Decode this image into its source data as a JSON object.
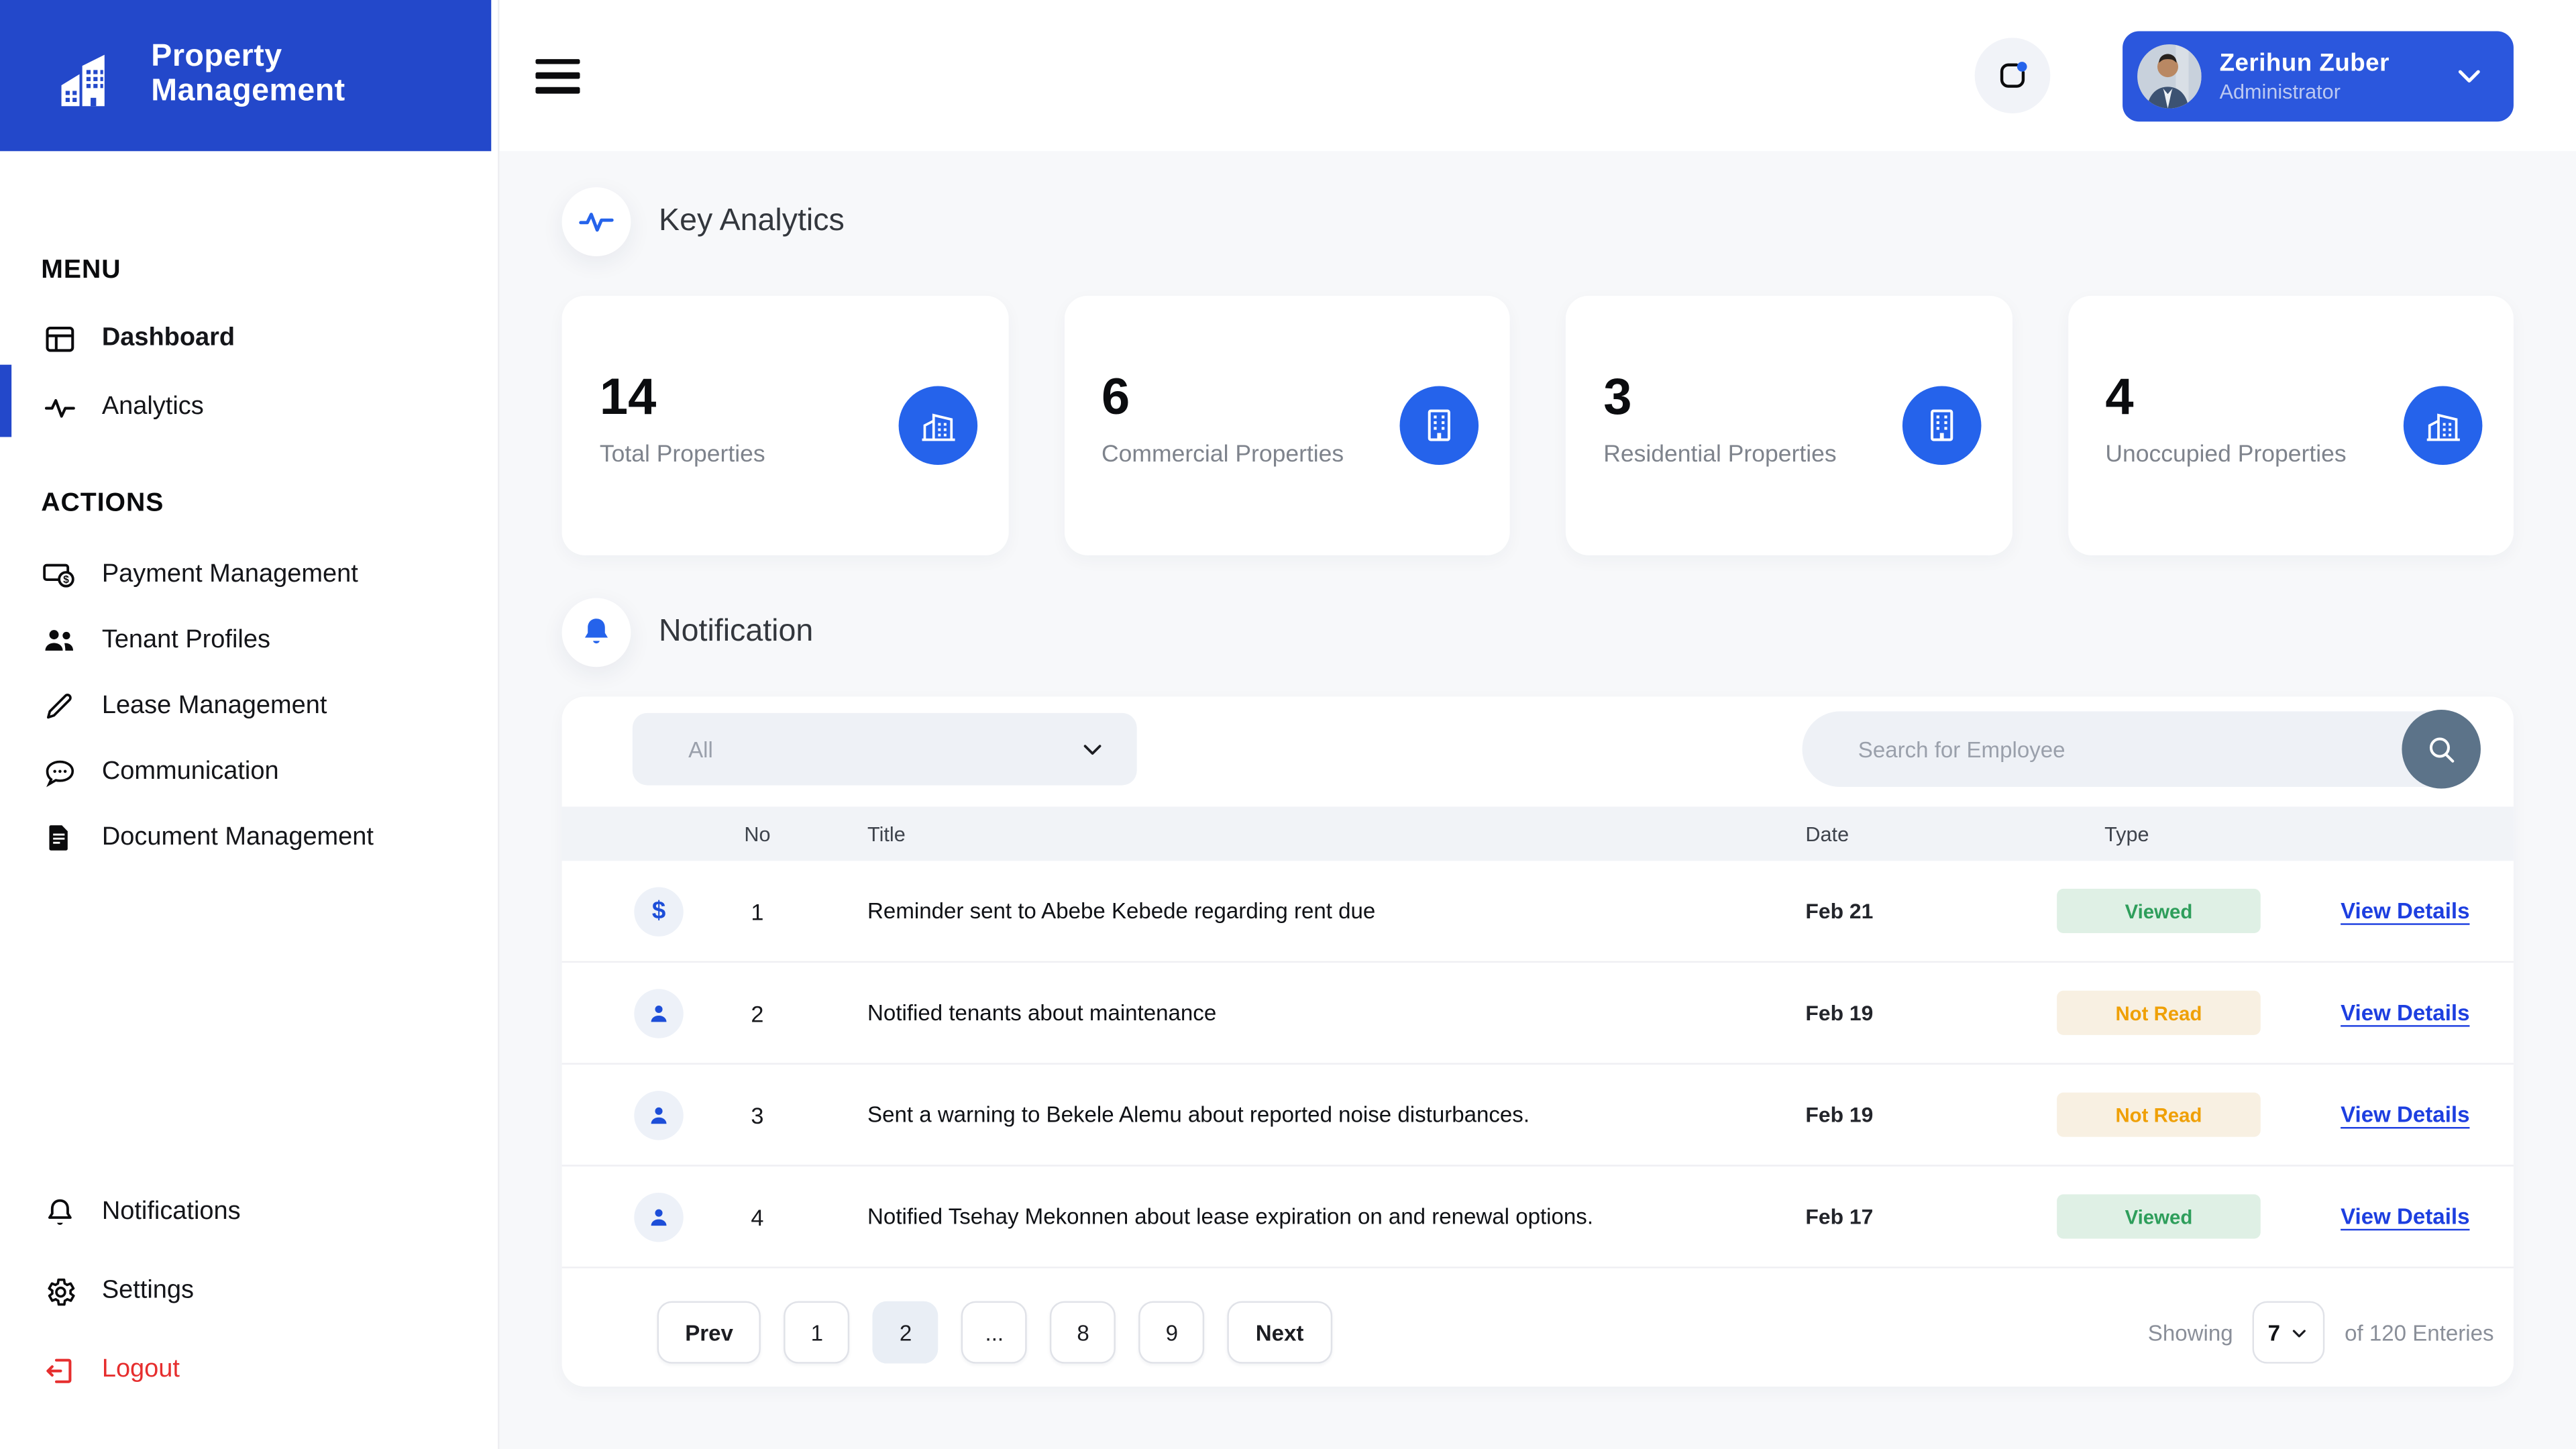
{
  "brand": {
    "line1": "Property",
    "line2": "Management"
  },
  "header": {
    "user_name": "Zerihun Zuber",
    "user_role": "Administrator"
  },
  "sidebar": {
    "menu_label": "MENU",
    "actions_label": "ACTIONS",
    "menu_items": [
      {
        "label": "Dashboard",
        "icon": "dashboard-icon",
        "active": true
      },
      {
        "label": "Analytics",
        "icon": "pulse-icon",
        "active": false
      }
    ],
    "action_items": [
      {
        "label": "Payment Management",
        "icon": "payment-icon"
      },
      {
        "label": "Tenant Profiles",
        "icon": "tenants-icon"
      },
      {
        "label": "Lease Management",
        "icon": "pencil-icon"
      },
      {
        "label": "Communication",
        "icon": "chat-icon"
      },
      {
        "label": "Document Management",
        "icon": "document-icon"
      }
    ],
    "footer_items": [
      {
        "label": "Notifications",
        "icon": "bell-icon"
      },
      {
        "label": "Settings",
        "icon": "gear-icon"
      },
      {
        "label": "Logout",
        "icon": "logout-icon"
      }
    ]
  },
  "analytics": {
    "title": "Key Analytics",
    "cards": [
      {
        "value": "14",
        "label": "Total Properties",
        "icon": "buildings-icon"
      },
      {
        "value": "6",
        "label": "Commercial Properties",
        "icon": "building-icon"
      },
      {
        "value": "3",
        "label": "Residential Properties",
        "icon": "building-icon"
      },
      {
        "value": "4",
        "label": "Unoccupied Properties",
        "icon": "buildings-icon"
      }
    ]
  },
  "notifications": {
    "title": "Notification",
    "filter_value": "All",
    "search_placeholder": "Search for Employee",
    "columns": {
      "no": "No",
      "title": "Title",
      "date": "Date",
      "type": "Type"
    },
    "rows": [
      {
        "no": "1",
        "icon": "dollar-icon",
        "title": "Reminder sent to Abebe Kebede regarding rent due",
        "date": "Feb 21",
        "type": "Viewed",
        "action": "View Details"
      },
      {
        "no": "2",
        "icon": "person-icon",
        "title": "Notified tenants about maintenance",
        "date": "Feb 19",
        "type": "Not Read",
        "action": "View Details"
      },
      {
        "no": "3",
        "icon": "person-icon",
        "title": "Sent a warning to Bekele Alemu about reported noise disturbances.",
        "date": "Feb 19",
        "type": "Not Read",
        "action": "View Details"
      },
      {
        "no": "4",
        "icon": "person-icon",
        "title": "Notified Tsehay Mekonnen about lease expiration on and renewal options.",
        "date": "Feb 17",
        "type": "Viewed",
        "action": "View Details"
      }
    ],
    "pagination": {
      "prev": "Prev",
      "pages": [
        "1",
        "2",
        "...",
        "8",
        "9"
      ],
      "active_page": "2",
      "next": "Next"
    },
    "footer": {
      "showing_label": "Showing",
      "page_size": "7",
      "entries_label": "of 120 Enteries"
    }
  },
  "colors": {
    "brand_blue": "#2348CA",
    "chip_blue": "#2B57DD",
    "icon_blue": "#2563EB",
    "row_icon_blue": "#1D4ED8",
    "link_blue": "#1D3FE0",
    "viewed_bg": "#DFF0E5",
    "viewed_text": "#2E9E5B",
    "notread_bg": "#F8F0E2",
    "notread_text": "#EFA007",
    "logout_red": "#E62E2E",
    "search_btn": "#5C7389",
    "page_bg": "#F7F8FA",
    "panel_bg": "#FFFFFF",
    "strip_bg": "#F1F3F7",
    "field_bg": "#EEF1F6",
    "active_page_bg": "#E9EEF5"
  }
}
